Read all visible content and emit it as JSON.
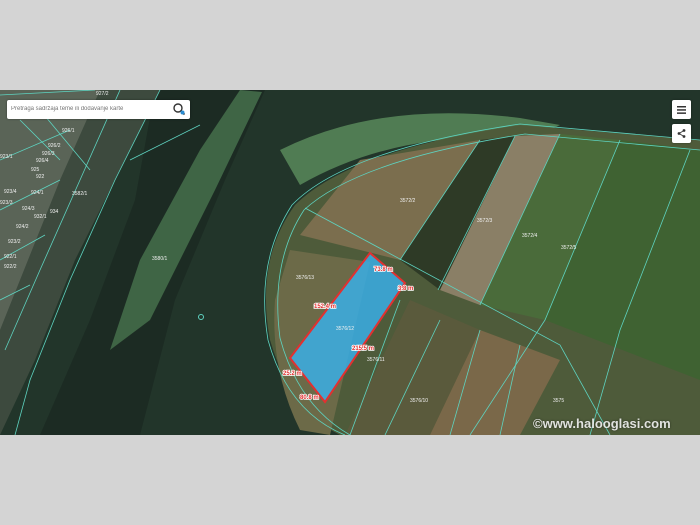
{
  "search": {
    "placeholder": "Pretraga sadržaja teme ili dodavanje karte"
  },
  "controls": {
    "menu_icon": "menu-icon",
    "share_icon": "share-icon"
  },
  "watermark": "©www.halooglasi.com",
  "parcels": [
    {
      "id": "927/2"
    },
    {
      "id": "926/1"
    },
    {
      "id": "926/2"
    },
    {
      "id": "926/3"
    },
    {
      "id": "926/4"
    },
    {
      "id": "925"
    },
    {
      "id": "924/1"
    },
    {
      "id": "924/2"
    },
    {
      "id": "924/3"
    },
    {
      "id": "923/4"
    },
    {
      "id": "923/1"
    },
    {
      "id": "923/3"
    },
    {
      "id": "923/2"
    },
    {
      "id": "922/1"
    },
    {
      "id": "922/2"
    },
    {
      "id": "922"
    },
    {
      "id": "934"
    },
    {
      "id": "932/1"
    },
    {
      "id": "3582/1"
    },
    {
      "id": "3580/1"
    },
    {
      "id": "3572/2"
    },
    {
      "id": "3572/3"
    },
    {
      "id": "3572/4"
    },
    {
      "id": "3572/5"
    },
    {
      "id": "3576/13"
    },
    {
      "id": "3576/12"
    },
    {
      "id": "3576/11"
    },
    {
      "id": "3576/10"
    },
    {
      "id": "3575"
    }
  ],
  "measurements": [
    "73.8 m",
    "3.8 m",
    "152.4 m",
    "215.5 m",
    "25.2 m",
    "80.8 m"
  ]
}
